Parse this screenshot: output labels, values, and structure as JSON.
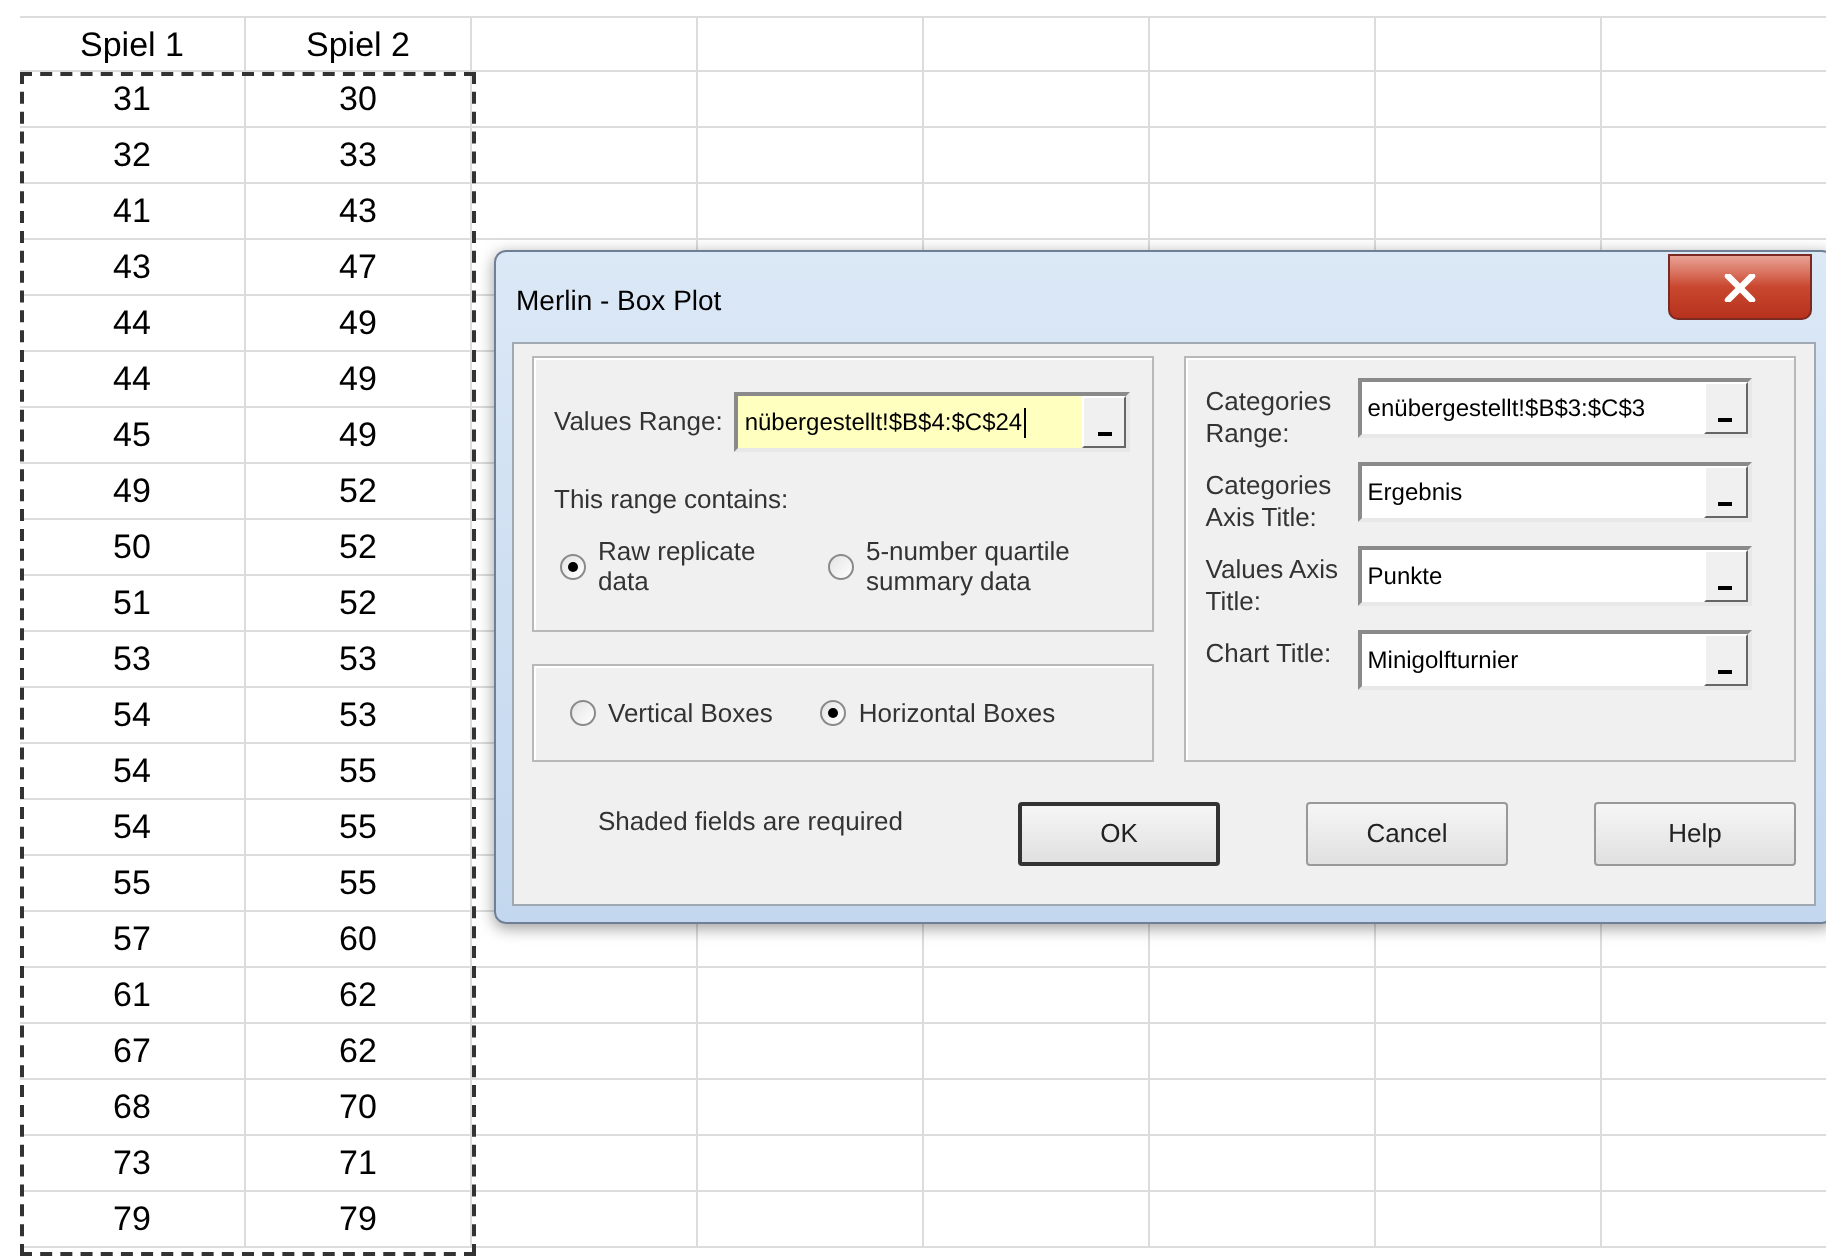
{
  "sheet": {
    "columns": [
      "Spiel 1",
      "Spiel 2"
    ],
    "rows": [
      [
        "31",
        "30"
      ],
      [
        "32",
        "33"
      ],
      [
        "41",
        "43"
      ],
      [
        "43",
        "47"
      ],
      [
        "44",
        "49"
      ],
      [
        "44",
        "49"
      ],
      [
        "45",
        "49"
      ],
      [
        "49",
        "52"
      ],
      [
        "50",
        "52"
      ],
      [
        "51",
        "52"
      ],
      [
        "53",
        "53"
      ],
      [
        "54",
        "53"
      ],
      [
        "54",
        "55"
      ],
      [
        "54",
        "55"
      ],
      [
        "55",
        "55"
      ],
      [
        "57",
        "60"
      ],
      [
        "61",
        "62"
      ],
      [
        "67",
        "62"
      ],
      [
        "68",
        "70"
      ],
      [
        "73",
        "71"
      ],
      [
        "79",
        "79"
      ]
    ]
  },
  "dialog": {
    "title": "Merlin - Box Plot",
    "values_range": {
      "label": "Values Range:",
      "value": "nübergestellt!$B$4:$C$24",
      "required": true
    },
    "range_contains": {
      "label": "This range contains:",
      "options": [
        {
          "label": "Raw replicate data",
          "selected": true
        },
        {
          "label": "5-number quartile summary data",
          "selected": false
        }
      ]
    },
    "orientation": {
      "options": [
        {
          "label": "Vertical Boxes",
          "selected": false
        },
        {
          "label": "Horizontal Boxes",
          "selected": true
        }
      ]
    },
    "fields": [
      {
        "label": "Categories Range:",
        "value": "enübergestellt!$B$3:$C$3",
        "required": false
      },
      {
        "label": "Categories Axis Title:",
        "value": "Ergebnis",
        "required": false
      },
      {
        "label": "Values Axis Title:",
        "value": "Punkte",
        "required": false
      },
      {
        "label": "Chart Title:",
        "value": "Minigolfturnier",
        "required": false
      }
    ],
    "note": "Shaded fields are required",
    "buttons": [
      {
        "label": "OK",
        "default": true
      },
      {
        "label": "Cancel",
        "default": false
      },
      {
        "label": "Help",
        "default": false
      }
    ]
  }
}
